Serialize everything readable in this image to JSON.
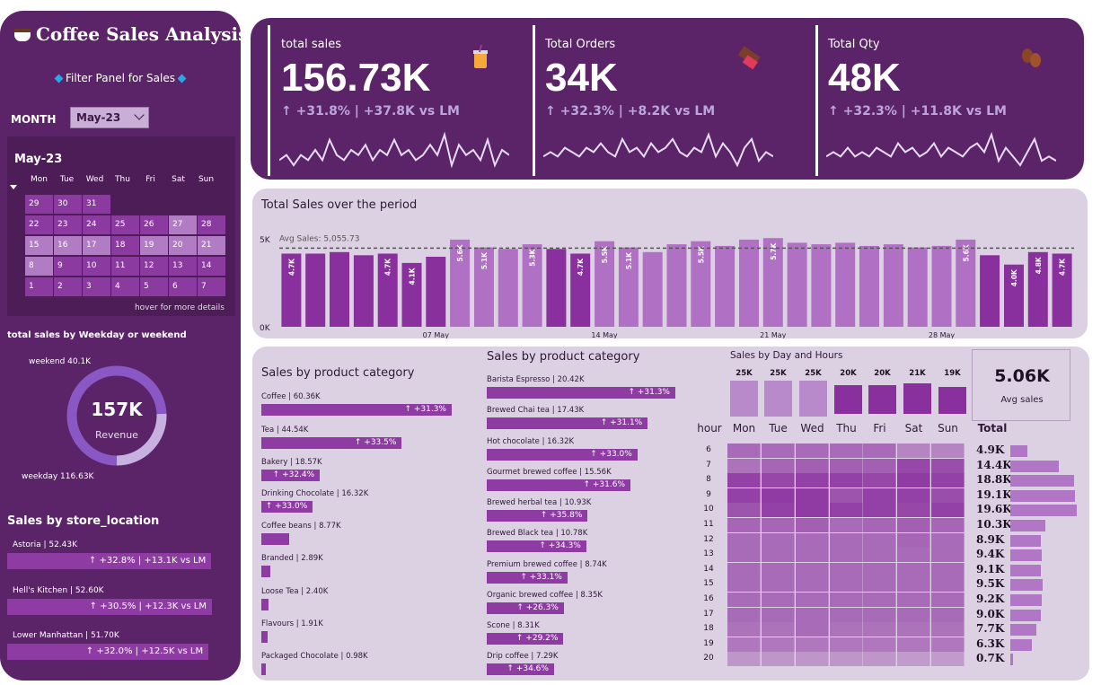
{
  "app": {
    "title": "Coffee Sales Analysis"
  },
  "filter": {
    "title": "Filter Panel for Sales",
    "month_label": "MONTH",
    "month_value": "May-23"
  },
  "calendar": {
    "title": "May-23",
    "days": [
      "Mon",
      "Tue",
      "Wed",
      "Thu",
      "Fri",
      "Sat",
      "Sun"
    ],
    "weeks": [
      [
        "29",
        "30",
        "31",
        "",
        "",
        "",
        ""
      ],
      [
        "22",
        "23",
        "24",
        "25",
        "26",
        "27",
        "28"
      ],
      [
        "15",
        "16",
        "17",
        "18",
        "19",
        "20",
        "21"
      ],
      [
        "8",
        "9",
        "10",
        "11",
        "12",
        "13",
        "14"
      ],
      [
        "1",
        "2",
        "3",
        "4",
        "5",
        "6",
        "7"
      ]
    ],
    "hint": "hover for more details"
  },
  "weekday_weekend": {
    "title": "total sales by Weekday or weekend",
    "weekend_label": "weekend 40.1K",
    "weekday_label": "weekday 116.63K",
    "center_value": "157K",
    "center_label": "Revenue",
    "weekend_value": 40.1,
    "weekday_value": 116.63
  },
  "store_location": {
    "title": "Sales by store_location",
    "items": [
      {
        "name": "Astoria | 52.43K",
        "delta": "↑ +32.8% | +13.1K vs LM",
        "value": 52.43
      },
      {
        "name": "Hell's Kitchen | 52.60K",
        "delta": "↑ +30.5% | +12.3K vs LM",
        "value": 52.6
      },
      {
        "name": "Lower Manhattan | 51.70K",
        "delta": "↑ +32.0% | +12.5K vs LM",
        "value": 51.7
      }
    ]
  },
  "kpis": [
    {
      "label": "total sales",
      "value": "156.73K",
      "delta": "↑ +31.8% | +37.8K vs LM",
      "icon": "bubble-tea-icon",
      "spark": [
        5,
        6,
        4,
        6,
        5,
        7,
        5,
        9,
        6,
        5,
        7,
        6,
        8,
        5,
        7,
        6,
        9,
        6,
        7,
        5,
        6,
        8,
        6,
        10,
        4,
        8,
        6,
        7,
        5,
        9,
        4,
        7,
        6
      ]
    },
    {
      "label": "Total Orders",
      "value": "34K",
      "delta": "↑ +32.3% | +8.2K vs LM",
      "icon": "chocolate-bar-icon",
      "spark": [
        4,
        5,
        4,
        6,
        5,
        4,
        6,
        5,
        7,
        5,
        4,
        8,
        5,
        6,
        4,
        7,
        5,
        6,
        8,
        5,
        4,
        6,
        5,
        9,
        4,
        7,
        5,
        2,
        6,
        8,
        3,
        5,
        4
      ]
    },
    {
      "label": "Total Qty",
      "value": "48K",
      "delta": "↑ +32.3% | +11.8K vs LM",
      "icon": "coffee-beans-icon",
      "spark": [
        5,
        6,
        5,
        7,
        5,
        6,
        5,
        7,
        6,
        5,
        8,
        6,
        7,
        5,
        6,
        8,
        5,
        7,
        6,
        5,
        7,
        8,
        6,
        10,
        4,
        7,
        5,
        3,
        6,
        9,
        4,
        5,
        4
      ]
    }
  ],
  "period_chart": {
    "title": "Total Sales over the period",
    "avg_label": "Avg Sales: 5,055.73",
    "y_labels": [
      "5K",
      "0K"
    ],
    "x_labels": [
      "07 May",
      "14 May",
      "21 May",
      "28 May"
    ]
  },
  "chart_data": {
    "type": "bar",
    "title": "Total Sales over the period",
    "categories": [
      "1",
      "2",
      "3",
      "4",
      "5",
      "6",
      "7",
      "8",
      "9",
      "10",
      "11",
      "12",
      "13",
      "14",
      "15",
      "16",
      "17",
      "18",
      "19",
      "20",
      "21",
      "22",
      "23",
      "24",
      "25",
      "26",
      "27",
      "28",
      "29",
      "30",
      "31"
    ],
    "values": [
      4.7,
      4.7,
      4.8,
      4.6,
      4.7,
      4.1,
      4.5,
      5.6,
      5.1,
      5.0,
      5.3,
      5.0,
      4.7,
      5.5,
      5.1,
      4.8,
      5.3,
      5.5,
      5.2,
      5.6,
      5.7,
      5.4,
      5.3,
      5.4,
      5.2,
      5.3,
      5.1,
      5.2,
      5.6,
      4.6,
      4.0,
      4.8,
      4.7
    ],
    "data_labels": [
      "4.7K",
      "",
      "",
      "",
      "4.7K",
      "4.1K",
      "",
      "5.6K",
      "5.1K",
      "",
      "5.3K",
      "",
      "4.7K",
      "5.5K",
      "5.1K",
      "",
      "",
      "5.5K",
      "",
      "",
      "5.7K",
      "",
      "",
      "",
      "",
      "",
      "",
      "",
      "5.6K",
      "",
      "4.0K",
      "4.8K",
      "4.7K"
    ],
    "avg": 5.05573,
    "ylim": [
      0,
      6
    ],
    "ylabel": "",
    "xlabel": ""
  },
  "product_category": {
    "title": "Sales by product category",
    "items": [
      {
        "name": "Coffee | 60.36K",
        "delta": "↑ +31.3%",
        "value": 60.36
      },
      {
        "name": "Tea | 44.54K",
        "delta": "↑ +33.5%",
        "value": 44.54
      },
      {
        "name": "Bakery | 18.57K",
        "delta": "↑ +32.4%",
        "value": 18.57
      },
      {
        "name": "Drinking Chocolate | 16.32K",
        "delta": "↑ +33.0%",
        "value": 16.32
      },
      {
        "name": "Coffee beans | 8.77K",
        "delta": "",
        "value": 8.77
      },
      {
        "name": "Branded | 2.89K",
        "delta": "",
        "value": 2.89
      },
      {
        "name": "Loose Tea | 2.40K",
        "delta": "",
        "value": 2.4
      },
      {
        "name": "Flavours | 1.91K",
        "delta": "",
        "value": 1.91
      },
      {
        "name": "Packaged Chocolate | 0.98K",
        "delta": "",
        "value": 0.98
      }
    ]
  },
  "product_type": {
    "title": "Sales by product category",
    "items": [
      {
        "name": "Barista Espresso | 20.42K",
        "delta": "↑ +31.3%",
        "value": 20.42
      },
      {
        "name": "Brewed Chai tea | 17.43K",
        "delta": "↑ +31.1%",
        "value": 17.43
      },
      {
        "name": "Hot chocolate | 16.32K",
        "delta": "↑ +33.0%",
        "value": 16.32
      },
      {
        "name": "Gourmet brewed coffee | 15.56K",
        "delta": "↑ +31.6%",
        "value": 15.56
      },
      {
        "name": "Brewed herbal tea | 10.93K",
        "delta": "↑ +35.8%",
        "value": 10.93
      },
      {
        "name": "Brewed Black tea | 10.78K",
        "delta": "↑ +34.3%",
        "value": 10.78
      },
      {
        "name": "Premium brewed coffee | 8.74K",
        "delta": "↑ +33.1%",
        "value": 8.74
      },
      {
        "name": "Organic brewed coffee | 8.35K",
        "delta": "↑ +26.3%",
        "value": 8.35
      },
      {
        "name": "Scone | 8.31K",
        "delta": "↑ +29.2%",
        "value": 8.31
      },
      {
        "name": "Drip coffee | 7.29K",
        "delta": "↑ +34.6%",
        "value": 7.29
      }
    ]
  },
  "day_hours": {
    "title": "Sales by Day and Hours",
    "avg_value": "5.06K",
    "avg_label": "Avg sales",
    "dow_totals": [
      {
        "label": "25K",
        "value": 25,
        "highlight": false
      },
      {
        "label": "25K",
        "value": 25,
        "highlight": false
      },
      {
        "label": "25K",
        "value": 25,
        "highlight": false
      },
      {
        "label": "20K",
        "value": 20,
        "highlight": true
      },
      {
        "label": "20K",
        "value": 20,
        "highlight": true
      },
      {
        "label": "21K",
        "value": 21,
        "highlight": true
      },
      {
        "label": "19K",
        "value": 19,
        "highlight": true
      }
    ],
    "hour_header": "hour",
    "day_headers": [
      "Mon",
      "Tue",
      "Wed",
      "Thu",
      "Fri",
      "Sat",
      "Sun"
    ],
    "total_header": "Total",
    "hours": [
      "6",
      "7",
      "8",
      "9",
      "10",
      "11",
      "12",
      "13",
      "14",
      "15",
      "16",
      "17",
      "18",
      "19",
      "20"
    ],
    "totals": [
      "4.9K",
      "14.4K",
      "18.8K",
      "19.1K",
      "19.6K",
      "10.3K",
      "8.9K",
      "9.4K",
      "9.1K",
      "9.5K",
      "9.2K",
      "9.0K",
      "7.7K",
      "6.3K",
      "0.7K"
    ],
    "total_values": [
      4.9,
      14.4,
      18.8,
      19.1,
      19.6,
      10.3,
      8.9,
      9.4,
      9.1,
      9.5,
      9.2,
      9.0,
      7.7,
      6.3,
      0.7
    ],
    "heatmap": [
      [
        0.5,
        0.5,
        0.5,
        0.5,
        0.5,
        0.3,
        0.3
      ],
      [
        0.45,
        0.55,
        0.6,
        0.6,
        0.6,
        0.8,
        0.75
      ],
      [
        0.85,
        0.8,
        0.85,
        0.85,
        0.8,
        0.9,
        0.85
      ],
      [
        0.85,
        0.9,
        0.9,
        0.7,
        0.85,
        0.85,
        0.75
      ],
      [
        0.7,
        0.85,
        0.9,
        0.85,
        0.85,
        0.8,
        0.85
      ],
      [
        0.55,
        0.55,
        0.6,
        0.5,
        0.55,
        0.6,
        0.55
      ],
      [
        0.5,
        0.5,
        0.5,
        0.5,
        0.5,
        0.55,
        0.5
      ],
      [
        0.5,
        0.5,
        0.5,
        0.5,
        0.5,
        0.5,
        0.5
      ],
      [
        0.5,
        0.5,
        0.5,
        0.5,
        0.5,
        0.5,
        0.5
      ],
      [
        0.5,
        0.5,
        0.5,
        0.5,
        0.5,
        0.5,
        0.5
      ],
      [
        0.5,
        0.5,
        0.5,
        0.5,
        0.5,
        0.5,
        0.5
      ],
      [
        0.5,
        0.5,
        0.5,
        0.5,
        0.5,
        0.5,
        0.5
      ],
      [
        0.45,
        0.45,
        0.5,
        0.45,
        0.45,
        0.45,
        0.45
      ],
      [
        0.4,
        0.4,
        0.4,
        0.4,
        0.4,
        0.4,
        0.4
      ],
      [
        0.15,
        0.15,
        0.15,
        0.15,
        0.15,
        0.1,
        0.1
      ]
    ]
  }
}
